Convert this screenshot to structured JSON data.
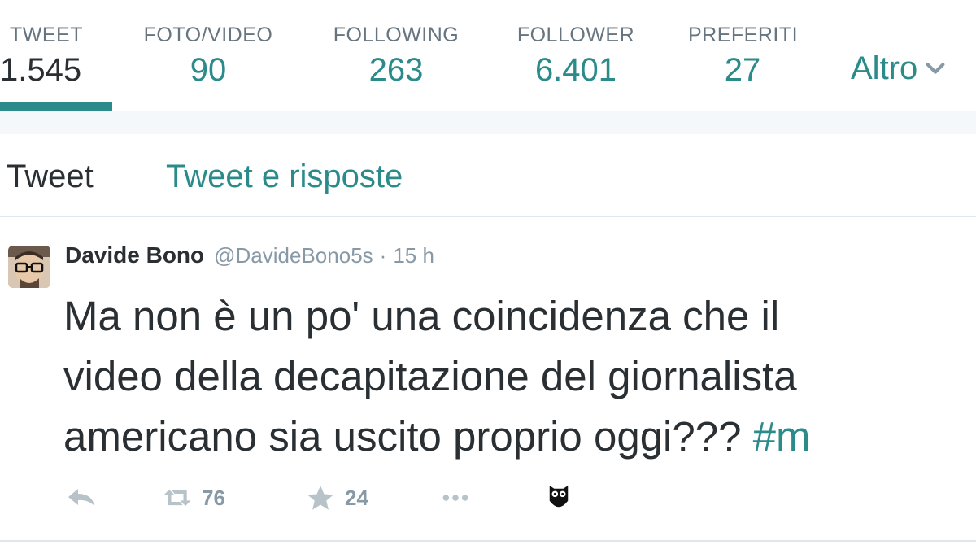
{
  "profile_nav": {
    "stats": [
      {
        "label": "TWEET",
        "value": "1.545"
      },
      {
        "label": "FOTO/VIDEO",
        "value": "90"
      },
      {
        "label": "FOLLOWING",
        "value": "263"
      },
      {
        "label": "FOLLOWER",
        "value": "6.401"
      },
      {
        "label": "PREFERITI",
        "value": "27"
      }
    ],
    "more_label": "Altro",
    "accent_color": "#2b8a8a"
  },
  "tabs": {
    "tweets": "Tweet",
    "tweets_replies": "Tweet e risposte"
  },
  "tweet": {
    "fullname": "Davide Bono",
    "handle": "@DavideBono5s",
    "separator": "·",
    "time": "15 h",
    "text_lines": [
      "Ma non è un po' una coincidenza che il",
      "video della decapitazione del giornalista",
      "americano sia uscito proprio oggi??? "
    ],
    "hashtag": "#m",
    "retweet_count": "76",
    "favorite_count": "24",
    "icons": [
      "reply-icon",
      "retweet-icon",
      "star-icon",
      "more-dots-icon",
      "owl-icon"
    ]
  }
}
